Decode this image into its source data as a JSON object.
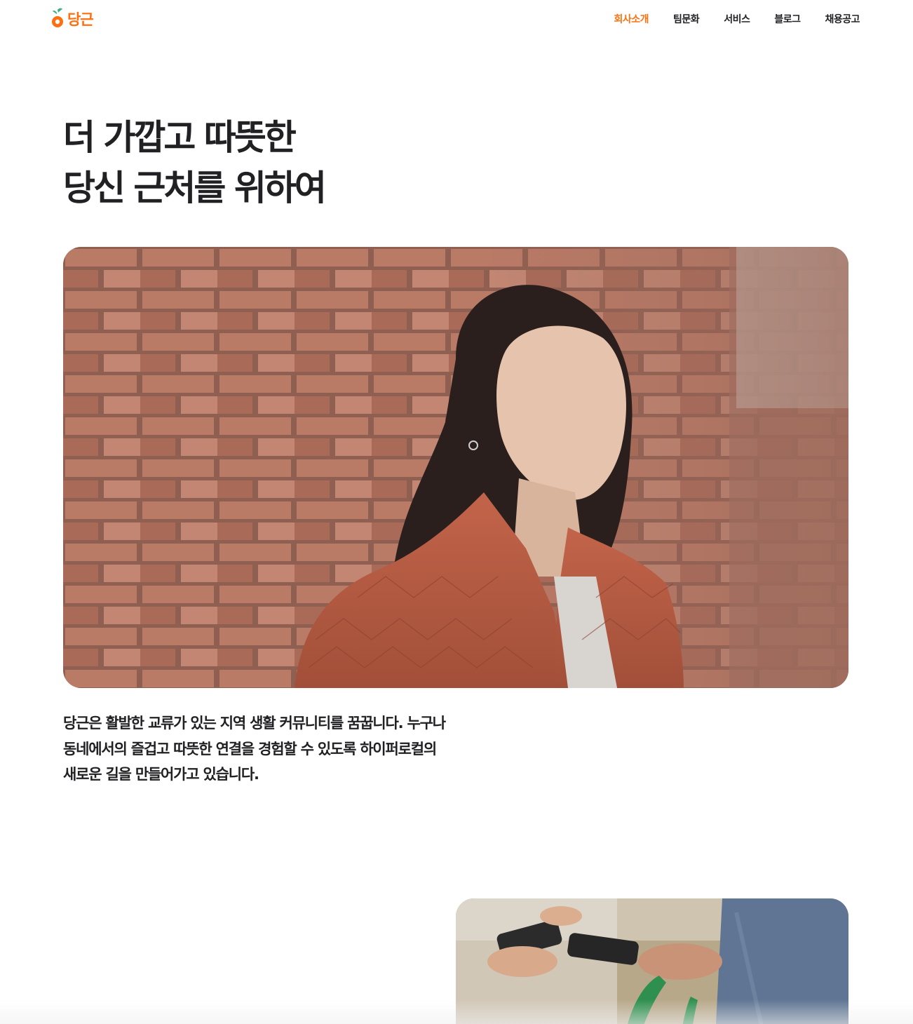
{
  "header": {
    "logo_text": "당근",
    "nav": [
      {
        "label": "회사소개",
        "active": true
      },
      {
        "label": "팀문화",
        "active": false
      },
      {
        "label": "서비스",
        "active": false
      },
      {
        "label": "블로그",
        "active": false
      },
      {
        "label": "채용공고",
        "active": false
      }
    ]
  },
  "hero": {
    "title_lines": [
      "더 가깝고 따뜻한",
      "당신 근처를 위하여"
    ]
  },
  "intro": {
    "lines": [
      "당근은 활발한 교류가 있는 지역 생활 커뮤니티를 꿈꿉니다. 누구나",
      "동네에서의 즐겁고 따뜻한 연결을 경험할 수 있도록 하이퍼로컬의",
      "새로운 길을 만들어가고 있습니다."
    ]
  },
  "colors": {
    "brand": "#ff6f0f",
    "text": "#212124",
    "background": "#ffffff"
  },
  "icons": {
    "logo": "carrot-icon"
  }
}
